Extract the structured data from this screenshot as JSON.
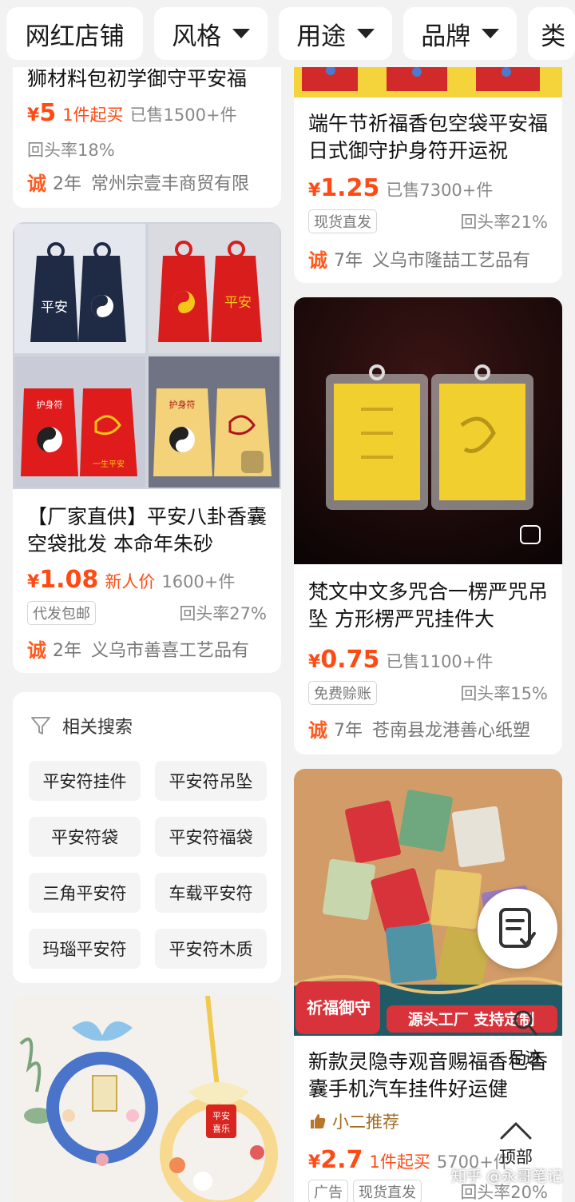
{
  "filter_bar": {
    "chips": [
      "网红店铺",
      "风格",
      "用途",
      "品牌",
      "类"
    ]
  },
  "left": {
    "card1": {
      "title": "狮材料包初学御守平安福",
      "price": "5",
      "price_tag": "1件起买",
      "sold": "已售1500+件",
      "repurchase": "回头率18%",
      "cheng": "诚",
      "years": "2年",
      "shop": "常州宗壹丰商贸有限"
    },
    "card2": {
      "image_labels": [
        "平安",
        "平安",
        "护身符",
        "一生平安",
        "护身符"
      ],
      "title": "【厂家直供】平安八卦香囊空袋批发 本命年朱砂",
      "price": "1.08",
      "price_tag": "新人价",
      "sold": "1600+件",
      "tag": "代发包邮",
      "repurchase": "回头率27%",
      "cheng": "诚",
      "years": "2年",
      "shop": "义乌市善喜工艺品有"
    },
    "related": {
      "heading": "相关搜索",
      "items": [
        "平安符挂件",
        "平安符吊坠",
        "平安符袋",
        "平安符福袋",
        "三角平安符",
        "车载平安符",
        "玛瑙平安符",
        "平安符木质"
      ]
    },
    "card3": {
      "image_labels": [
        "平安",
        "喜乐"
      ]
    }
  },
  "right": {
    "card1": {
      "title": "端午节祈福香包空袋平安福日式御守护身符开运祝",
      "price": "1.25",
      "sold": "已售7300+件",
      "tag": "现货直发",
      "repurchase": "回头率21%",
      "cheng": "诚",
      "years": "7年",
      "shop": "义乌市隆喆工艺品有"
    },
    "card2": {
      "title": "梵文中文多咒合一楞严咒吊坠 方形楞严咒挂件大",
      "price": "0.75",
      "sold": "已售1100+件",
      "tag": "免费赊账",
      "repurchase": "回头率15%",
      "cheng": "诚",
      "years": "7年",
      "shop": "苍南县龙港善心纸塑"
    },
    "card3": {
      "banner_left": "祈福御守",
      "banner_right": "源头工厂 支持定制",
      "title": "新款灵隐寺观音赐福香包香囊手机汽车挂件好运健",
      "recommend": "小二推荐",
      "price": "2.7",
      "price_tag": "1件起买",
      "sold": "5700+件",
      "tag1": "广告",
      "tag2": "现货直发",
      "repurchase": "回头率20%"
    }
  },
  "side": {
    "zuji": "足迹",
    "top": "顶部"
  },
  "currency": "¥",
  "watermark": "知乎 @永哥笔记",
  "colors": {
    "price": "#ff4a14",
    "background": "#f2f2f2",
    "card": "#ffffff"
  }
}
